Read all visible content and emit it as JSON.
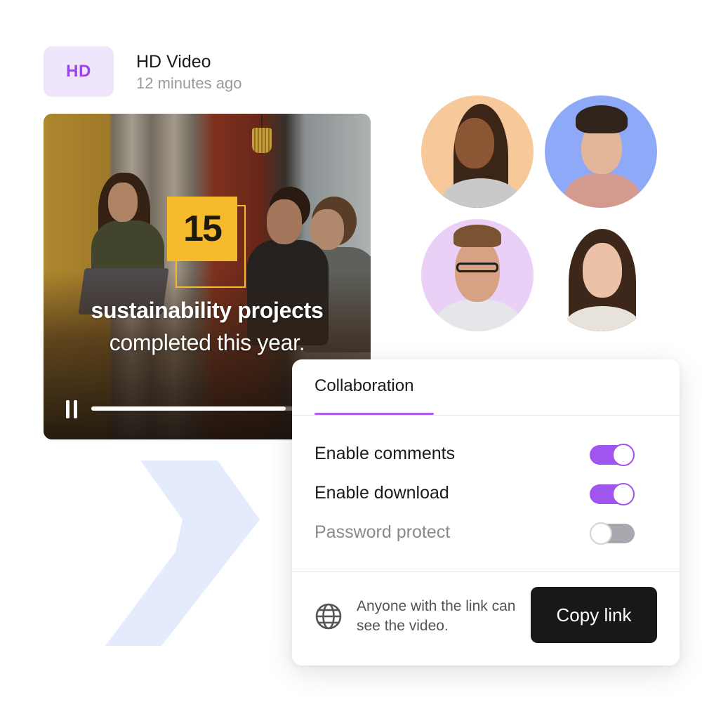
{
  "header": {
    "badge": "HD",
    "title": "HD Video",
    "timestamp": "12 minutes ago"
  },
  "video": {
    "stat_number": "15",
    "headline": "sustainability projects",
    "subline": "completed this year.",
    "progress": 0.73,
    "state": "playing"
  },
  "avatars": [
    {
      "name": "avatar-1",
      "bg": "#f7c99a"
    },
    {
      "name": "avatar-2",
      "bg": "#8ea9f7"
    },
    {
      "name": "avatar-3",
      "bg": "#ead0f6"
    },
    {
      "name": "avatar-4",
      "bg": "#ffffff"
    }
  ],
  "panel": {
    "tab_label": "Collaboration",
    "settings": [
      {
        "label": "Enable comments",
        "enabled": true
      },
      {
        "label": "Enable download",
        "enabled": true
      },
      {
        "label": "Password protect",
        "enabled": false
      }
    ],
    "share_text": "Anyone with the link can see the video.",
    "copy_label": "Copy link",
    "icon": "globe-icon"
  },
  "colors": {
    "accent": "#a055ee",
    "badge_bg": "#efe6fb",
    "badge_text": "#9b45ee",
    "stat_yellow": "#f6bb2d",
    "button_bg": "#18181b",
    "chevron": "#e3ebfd"
  }
}
